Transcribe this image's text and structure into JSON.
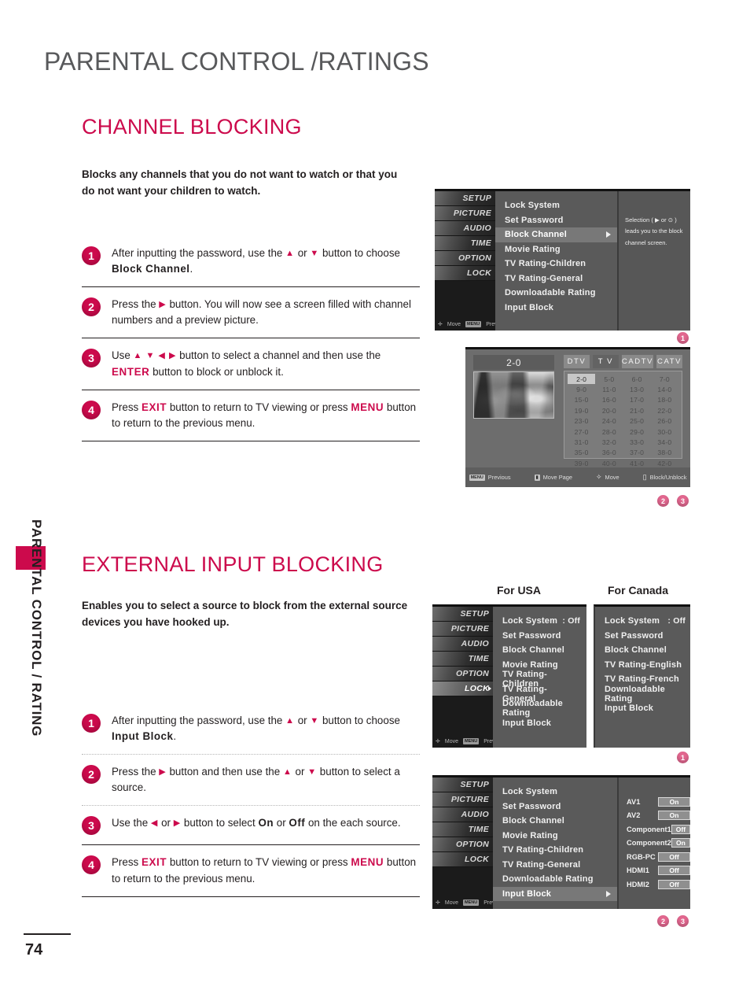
{
  "page": {
    "title": "PARENTAL CONTROL /RATINGS",
    "number": "74",
    "side_label": "PARENTAL CONTROL / RATING"
  },
  "section1": {
    "heading": "CHANNEL BLOCKING",
    "intro": "Blocks any channels that you do not want to watch or that you do not want your children to watch.",
    "steps": [
      {
        "n": "1",
        "html": "After inputting the password, use the <span class=\"ar\">▲</span> or <span class=\"ar\">▼</span> button to choose <span class=\"b\">Block Channel</span>."
      },
      {
        "n": "2",
        "html": "Press the <span class=\"ar\">▶</span> button. You will now see a screen filled with channel numbers and a preview picture."
      },
      {
        "n": "3",
        "html": "Use <span class=\"ar\">▲ ▼ ◀ ▶</span> button to select a channel and then use the <span class=\"k\">ENTER</span> button to block or unblock it."
      },
      {
        "n": "4",
        "html": "Press <span class=\"k\">EXIT</span> button to return to TV viewing or press <span class=\"k\">MENU</span> button to return to the previous menu."
      }
    ]
  },
  "section2": {
    "heading": "EXTERNAL INPUT BLOCKING",
    "intro": "Enables you to select a source to block from the external source devices you have hooked up.",
    "caption_usa": "For USA",
    "caption_canada": "For Canada",
    "steps": [
      {
        "n": "1",
        "html": "After inputting the password, use the <span class=\"ar\">▲</span> or <span class=\"ar\">▼</span> button to choose <span class=\"b\">Input Block</span>."
      },
      {
        "n": "2",
        "html": "Press the <span class=\"ar\">▶</span> button and then use the <span class=\"ar\">▲</span> or <span class=\"ar\">▼</span> button to select a source."
      },
      {
        "n": "3",
        "html": "Use the <span class=\"ar\">◀</span> or <span class=\"ar\">▶</span> button to select <span class=\"b\">On</span> or <span class=\"b\">Off</span> on the each source."
      },
      {
        "n": "4",
        "html": "Press <span class=\"k\">EXIT</span> button to return to TV viewing or press <span class=\"k\">MENU</span> button to return to the previous menu."
      }
    ]
  },
  "osd_common": {
    "side_items": [
      "SETUP",
      "PICTURE",
      "AUDIO",
      "TIME",
      "OPTION",
      "LOCK"
    ],
    "footer_move": "Move",
    "footer_menu_key": "MENU",
    "footer_prev": "Prev"
  },
  "osd_block_channel": {
    "menu": [
      {
        "label": "Lock System",
        "value": "",
        "selected": false,
        "arrow": false
      },
      {
        "label": "Set Password",
        "value": "",
        "selected": false,
        "arrow": false
      },
      {
        "label": "Block Channel",
        "value": "",
        "selected": true,
        "arrow": true
      },
      {
        "label": "Movie Rating",
        "value": "",
        "selected": false,
        "arrow": false
      },
      {
        "label": "TV Rating-Children",
        "value": "",
        "selected": false,
        "arrow": false
      },
      {
        "label": "TV Rating-General",
        "value": "",
        "selected": false,
        "arrow": false
      },
      {
        "label": "Downloadable Rating",
        "value": "",
        "selected": false,
        "arrow": false
      },
      {
        "label": "Input Block",
        "value": "",
        "selected": false,
        "arrow": false
      }
    ],
    "description": "Selection ( ▶ or ⊙ ) leads you to the block channel screen.",
    "callout": "1"
  },
  "channel_grid": {
    "current_channel": "2-0",
    "tabs": [
      {
        "label": "DTV",
        "selected": false
      },
      {
        "label": "T V",
        "selected": true
      },
      {
        "label": "CADTV",
        "selected": false
      },
      {
        "label": "CATV",
        "selected": false
      }
    ],
    "rows": [
      [
        "2-0",
        "5-0",
        "6-0",
        "7-0"
      ],
      [
        "9-0",
        "11-0",
        "13-0",
        "14-0"
      ],
      [
        "15-0",
        "16-0",
        "17-0",
        "18-0"
      ],
      [
        "19-0",
        "20-0",
        "21-0",
        "22-0"
      ],
      [
        "23-0",
        "24-0",
        "25-0",
        "26-0"
      ],
      [
        "27-0",
        "28-0",
        "29-0",
        "30-0"
      ],
      [
        "31-0",
        "32-0",
        "33-0",
        "34-0"
      ],
      [
        "35-0",
        "36-0",
        "37-0",
        "38-0"
      ],
      [
        "39-0",
        "40-0",
        "41-0",
        "42-0"
      ]
    ],
    "selected_cell": {
      "row": 0,
      "col": 0
    },
    "hints": [
      {
        "key": "MENU",
        "label": "Previous"
      },
      {
        "key": "PAGE",
        "label": "Move Page"
      },
      {
        "key": "NAV",
        "label": "Move"
      },
      {
        "key": "ENTER",
        "label": "Block/Unblock"
      }
    ],
    "callouts": [
      "2",
      "3"
    ]
  },
  "osd_usa": {
    "menu": [
      {
        "label": "Lock System",
        "value": ": Off",
        "selected": false,
        "arrow": false
      },
      {
        "label": "Set Password",
        "value": "",
        "selected": false,
        "arrow": false
      },
      {
        "label": "Block Channel",
        "value": "",
        "selected": false,
        "arrow": false
      },
      {
        "label": "Movie Rating",
        "value": "",
        "selected": false,
        "arrow": false
      },
      {
        "label": "TV Rating-Children",
        "value": "",
        "selected": false,
        "arrow": false
      },
      {
        "label": "TV Rating-General",
        "value": "",
        "selected": false,
        "arrow": false
      },
      {
        "label": "Downloadable Rating",
        "value": "",
        "selected": false,
        "arrow": false
      },
      {
        "label": "Input Block",
        "value": "",
        "selected": false,
        "arrow": false
      }
    ]
  },
  "osd_canada": {
    "menu": [
      {
        "label": "Lock System",
        "value": ": Off",
        "selected": false,
        "arrow": false
      },
      {
        "label": "Set Password",
        "value": "",
        "selected": false,
        "arrow": false
      },
      {
        "label": "Block Channel",
        "value": "",
        "selected": false,
        "arrow": false
      },
      {
        "label": "TV Rating-English",
        "value": "",
        "selected": false,
        "arrow": false
      },
      {
        "label": "TV Rating-French",
        "value": "",
        "selected": false,
        "arrow": false
      },
      {
        "label": "Downloadable Rating",
        "value": "",
        "selected": false,
        "arrow": false
      },
      {
        "label": "Input Block",
        "value": "",
        "selected": false,
        "arrow": false
      }
    ],
    "callout": "1"
  },
  "osd_input_block": {
    "menu": [
      {
        "label": "Lock System",
        "value": "",
        "selected": false,
        "arrow": false
      },
      {
        "label": "Set Password",
        "value": "",
        "selected": false,
        "arrow": false
      },
      {
        "label": "Block Channel",
        "value": "",
        "selected": false,
        "arrow": false
      },
      {
        "label": "Movie Rating",
        "value": "",
        "selected": false,
        "arrow": false
      },
      {
        "label": "TV Rating-Children",
        "value": "",
        "selected": false,
        "arrow": false
      },
      {
        "label": "TV Rating-General",
        "value": "",
        "selected": false,
        "arrow": false
      },
      {
        "label": "Downloadable Rating",
        "value": "",
        "selected": false,
        "arrow": false
      },
      {
        "label": "Input Block",
        "value": "",
        "selected": true,
        "arrow": true
      }
    ],
    "sources": [
      {
        "name": "AV1",
        "value": "On"
      },
      {
        "name": "AV2",
        "value": "On"
      },
      {
        "name": "Component1",
        "value": "Off"
      },
      {
        "name": "Component2",
        "value": "On"
      },
      {
        "name": "RGB-PC",
        "value": "Off"
      },
      {
        "name": "HDMI1",
        "value": "Off"
      },
      {
        "name": "HDMI2",
        "value": "Off"
      }
    ],
    "callouts": [
      "2",
      "3"
    ]
  },
  "colors": {
    "accent": "#cc0a4c",
    "callout": "#e2678f",
    "title_gray": "#58595b"
  }
}
